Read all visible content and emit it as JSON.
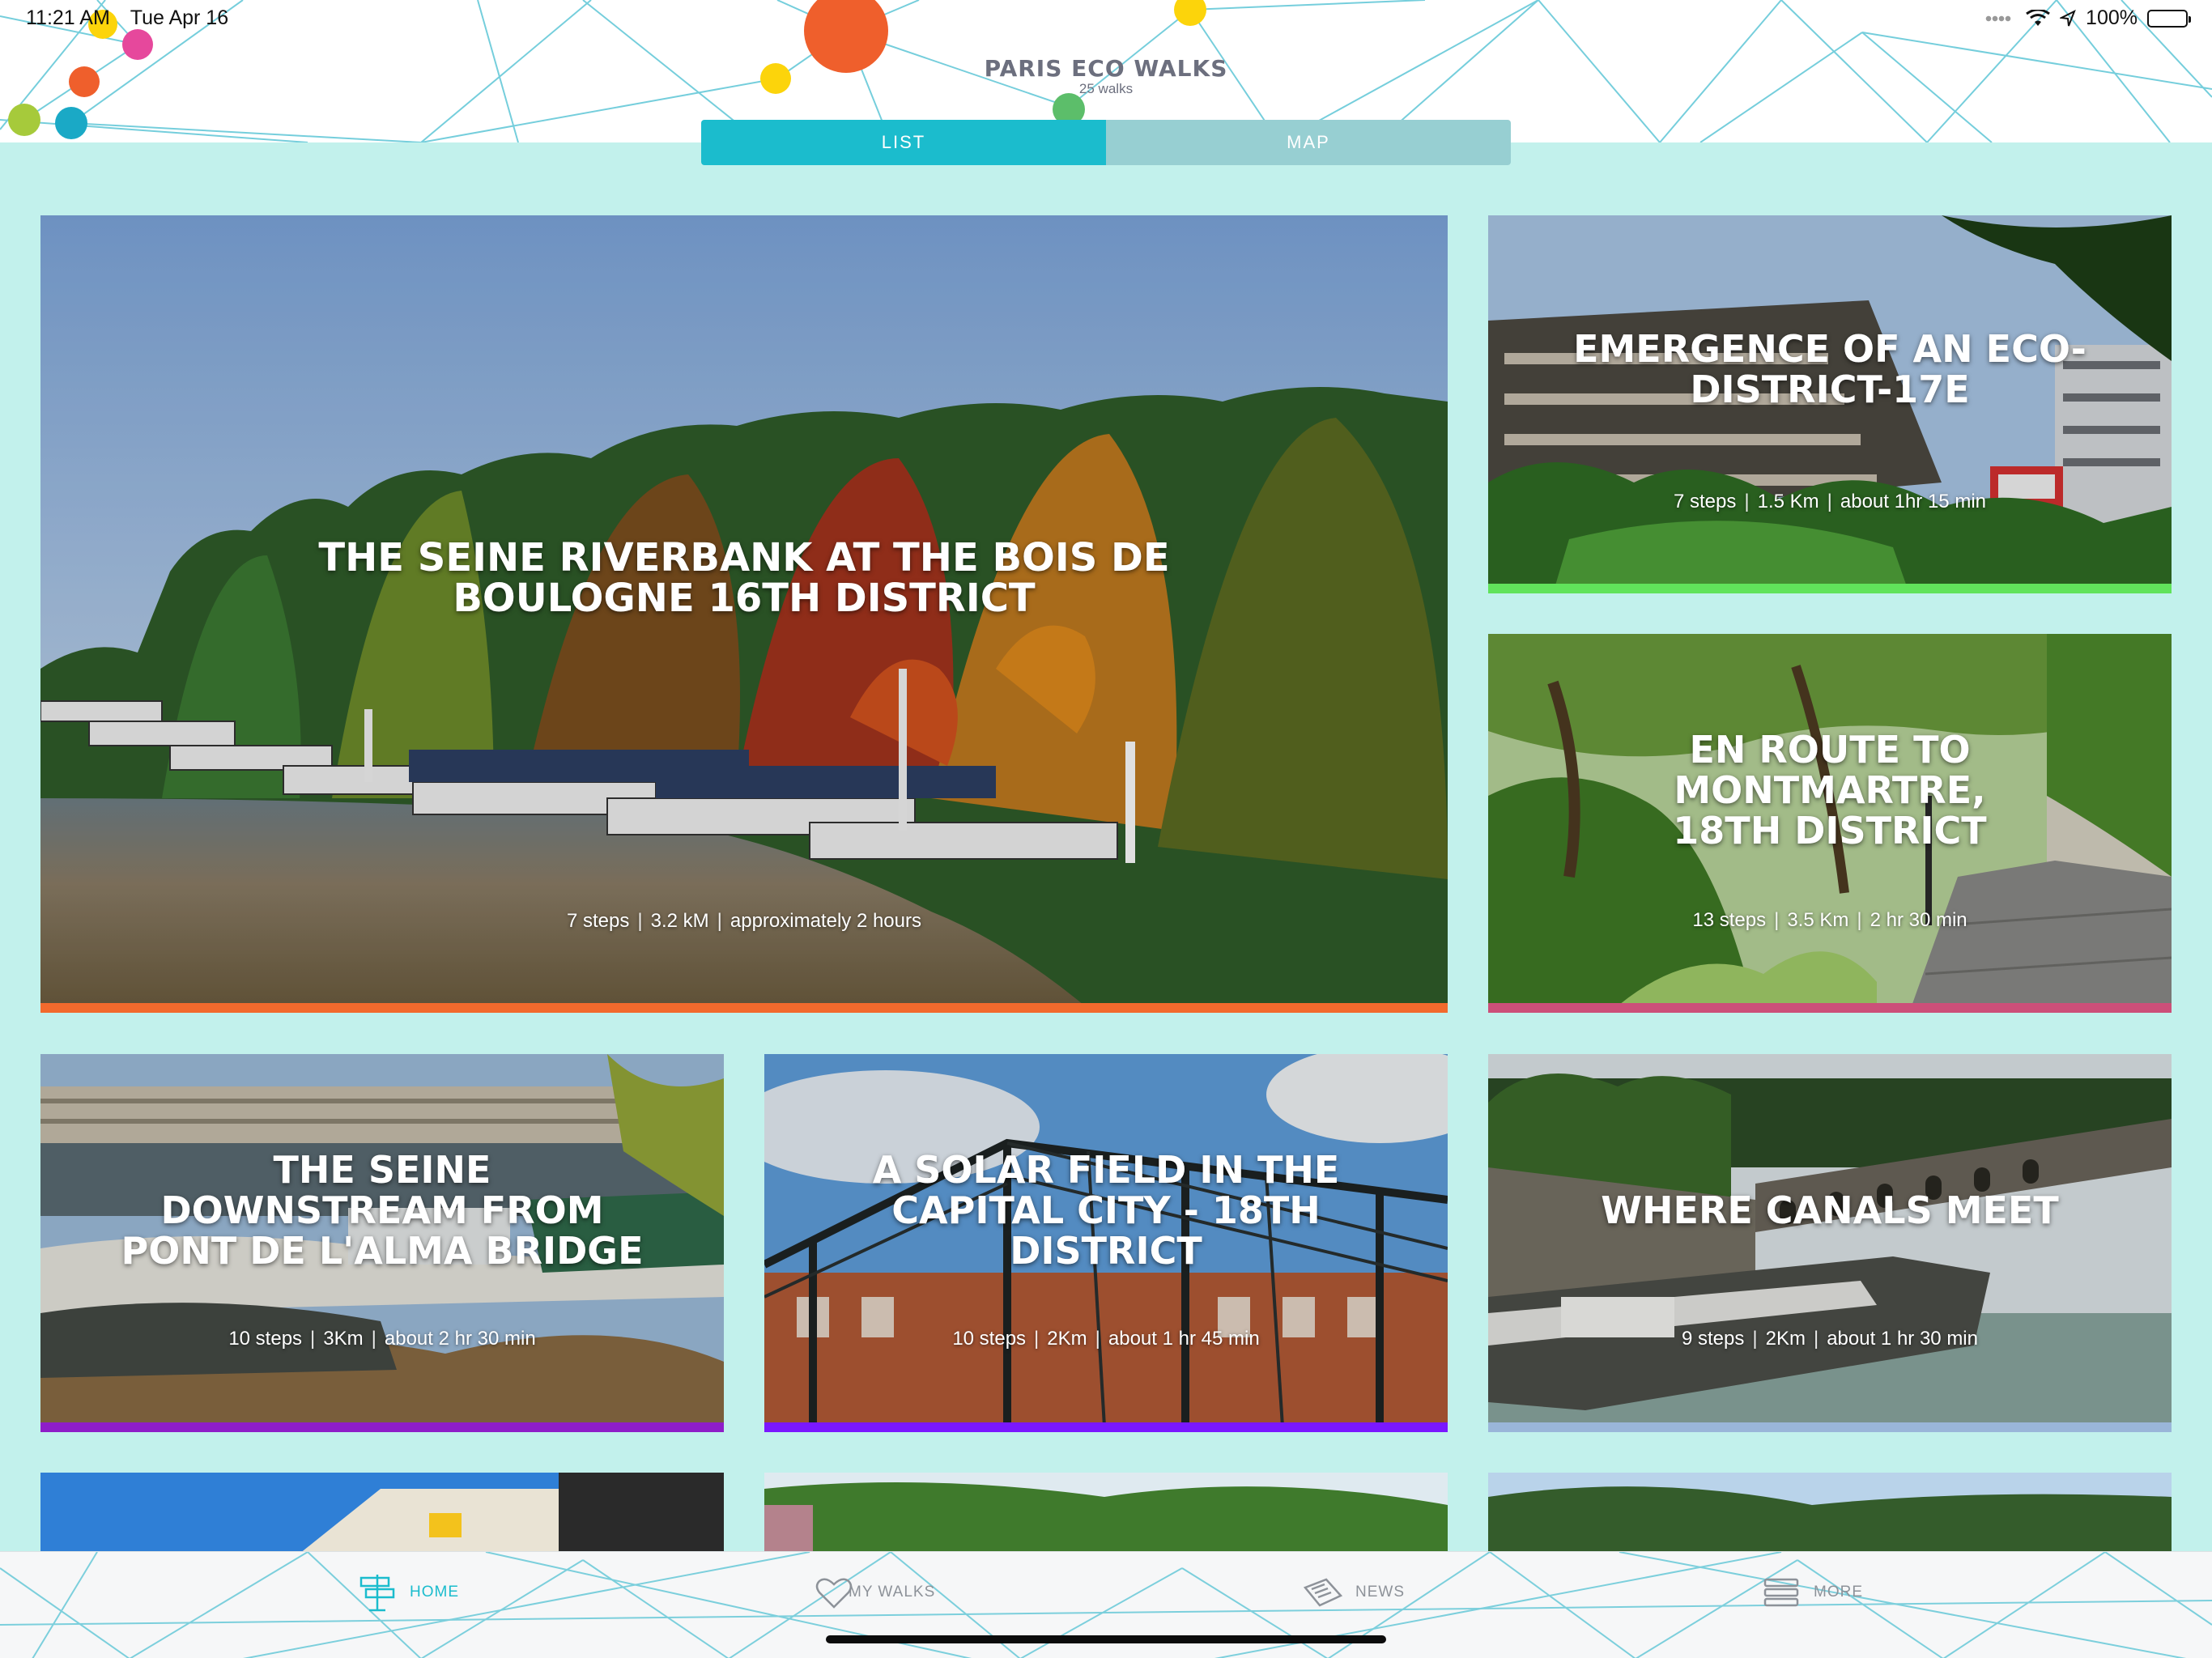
{
  "status_bar": {
    "time": "11:21 AM",
    "date": "Tue Apr 16",
    "battery": "100%",
    "battery_level": 1.0
  },
  "header": {
    "title": "PARIS ECO WALKS",
    "subtitle": "25 walks"
  },
  "segmented_control": {
    "options": [
      "LIST",
      "MAP"
    ],
    "selected": "LIST",
    "active_color": "#1bbccd",
    "inactive_color": "#97cfd2"
  },
  "walks": [
    {
      "title": "THE SEINE RIVERBANK AT THE BOIS DE BOULOGNE 16th DISTRICT",
      "meta": [
        "7 steps",
        "3.2 kM",
        "approximately 2 hours"
      ],
      "accent": "#f26a2d"
    },
    {
      "title": "EMERGENCE OF AN ECO-DISTRICT-17e",
      "meta": [
        "7 steps",
        "1.5 Km",
        "about 1hr 15 min"
      ],
      "accent": "#61e35b"
    },
    {
      "title": "EN ROUTE TO MONTMARTRE, 18th DISTRICT",
      "meta": [
        "13 steps",
        "3.5 Km",
        "2 hr 30 min"
      ],
      "accent": "#cc4f79"
    },
    {
      "title": "THE SEINE DOWNSTREAM FROM PONT DE L'ALMA BRIDGE",
      "meta": [
        "10 steps",
        "3Km",
        "about 2 hr 30 min"
      ],
      "accent": "#8e1ec8"
    },
    {
      "title": "A SOLAR FIELD IN THE CAPITAL CITY - 18th DISTRICT",
      "meta": [
        "10 steps",
        "2Km",
        "about 1 hr 45 min"
      ],
      "accent": "#7a18ff"
    },
    {
      "title": "WHERE CANALS MEET",
      "meta": [
        "9 steps",
        "2Km",
        "about 1 hr 30 min"
      ],
      "accent": "#9ab6d9"
    }
  ],
  "tab_bar": {
    "items": [
      {
        "label": "HOME",
        "icon": "signpost-icon",
        "active": true
      },
      {
        "label": "MY WALKS",
        "icon": "heart-icon",
        "active": false
      },
      {
        "label": "NEWS",
        "icon": "newspaper-icon",
        "active": false
      },
      {
        "label": "MORE",
        "icon": "menu-icon",
        "active": false
      }
    ]
  }
}
